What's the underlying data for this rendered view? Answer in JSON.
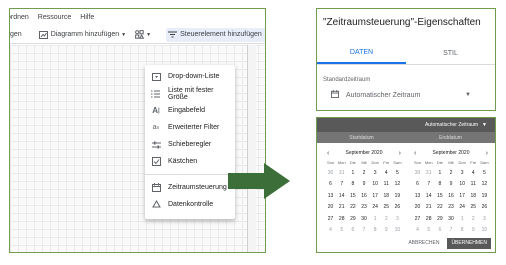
{
  "editor": {
    "menu": [
      "ordnen",
      "Ressource",
      "Hilfe"
    ],
    "toolbar": {
      "left_cut": "gen",
      "add_chart": "Diagramm hinzufügen",
      "add_control": "Steuerelement hinzufügen"
    },
    "dropdown": {
      "items": [
        {
          "label": "Drop-down-Liste",
          "icon": "dropdown-list-icon"
        },
        {
          "label": "Liste mit fester Größe",
          "icon": "list-icon"
        },
        {
          "label": "Eingabefeld",
          "icon": "text-input-icon"
        },
        {
          "label": "Erweiterter Filter",
          "icon": "advanced-filter-icon"
        },
        {
          "label": "Schieberegler",
          "icon": "slider-icon"
        },
        {
          "label": "Kästchen",
          "icon": "checkbox-icon"
        },
        {
          "label": "Zeitraumsteuerung",
          "icon": "calendar-icon"
        },
        {
          "label": "Datenkontrolle",
          "icon": "data-control-icon"
        }
      ]
    }
  },
  "properties": {
    "title": "\"Zeitraumsteuerung\"-Eigenschaften",
    "tabs": [
      "DATEN",
      "STIL"
    ],
    "field_label": "Standardzeitraum",
    "field_value": "Automatischer Zeitraum"
  },
  "picker": {
    "mode": "Automatischer Zeitraum",
    "start_label": "Startdatum",
    "end_label": "Enddatum",
    "month": "September 2020",
    "weekdays": [
      "Son",
      "Mon",
      "Die",
      "Mit",
      "Don",
      "Fre",
      "Sam"
    ],
    "days": [
      [
        "30",
        "31",
        "1",
        "2",
        "3",
        "4",
        "5"
      ],
      [
        "6",
        "7",
        "8",
        "9",
        "10",
        "11",
        "12"
      ],
      [
        "13",
        "14",
        "15",
        "16",
        "17",
        "18",
        "19"
      ],
      [
        "20",
        "21",
        "22",
        "23",
        "24",
        "25",
        "26"
      ],
      [
        "27",
        "28",
        "29",
        "30",
        "1",
        "2",
        "3"
      ],
      [
        "4",
        "5",
        "6",
        "7",
        "8",
        "9",
        "10"
      ]
    ],
    "cancel": "ABBRECHEN",
    "apply": "ÜBERNEHMEN"
  },
  "colors": {
    "frame": "#6f9d4d",
    "arrow": "#3c6e39",
    "accent": "#1a73e8",
    "dark_header": "#595959"
  }
}
